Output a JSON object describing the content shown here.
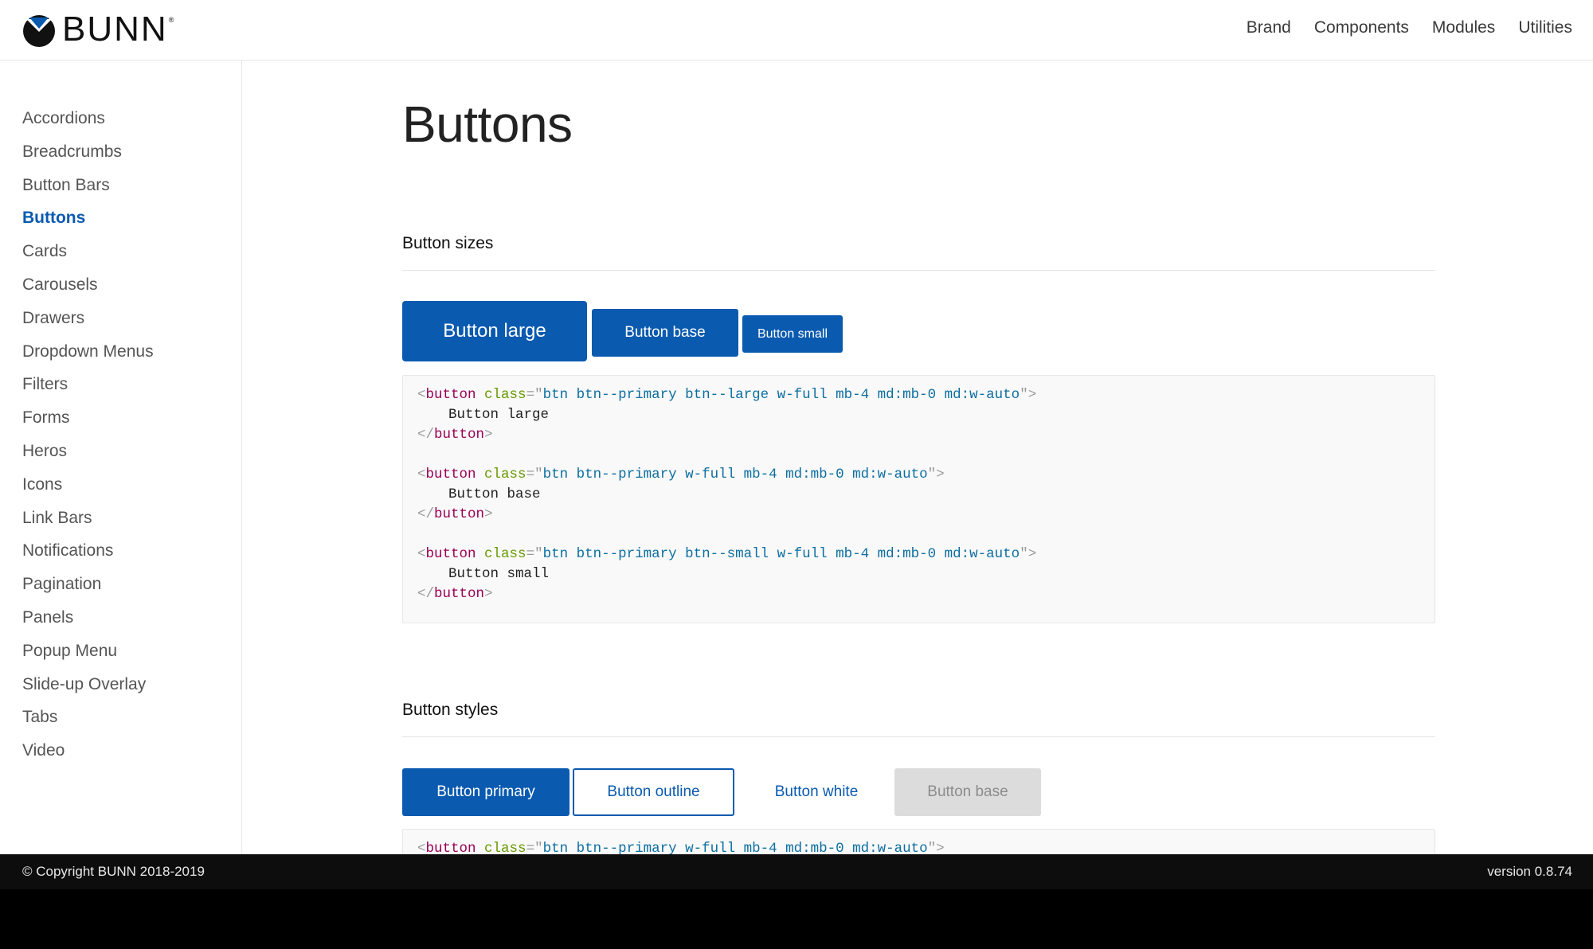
{
  "brand": {
    "name": "BUNN",
    "registered_mark": "®",
    "accent_color": "#0a5ab0"
  },
  "topnav": [
    "Brand",
    "Components",
    "Modules",
    "Utilities"
  ],
  "sidebar": {
    "items": [
      "Accordions",
      "Breadcrumbs",
      "Button Bars",
      "Buttons",
      "Cards",
      "Carousels",
      "Drawers",
      "Dropdown Menus",
      "Filters",
      "Forms",
      "Heros",
      "Icons",
      "Link Bars",
      "Notifications",
      "Pagination",
      "Panels",
      "Popup Menu",
      "Slide-up Overlay",
      "Tabs",
      "Video"
    ],
    "active": "Buttons"
  },
  "main": {
    "title": "Buttons",
    "sizes": {
      "heading": "Button sizes",
      "buttons": {
        "large": "Button large",
        "base": "Button base",
        "small": "Button small"
      },
      "code": [
        {
          "tag": "button",
          "attr": "class",
          "value": "btn btn--primary btn--large w-full mb-4 md:mb-0 md:w-auto",
          "text": "Button large"
        },
        {
          "tag": "button",
          "attr": "class",
          "value": "btn btn--primary w-full mb-4 md:mb-0 md:w-auto",
          "text": "Button base"
        },
        {
          "tag": "button",
          "attr": "class",
          "value": "btn btn--primary btn--small w-full mb-4 md:mb-0 md:w-auto",
          "text": "Button small"
        }
      ]
    },
    "styles": {
      "heading": "Button styles",
      "buttons": {
        "primary": "Button primary",
        "outline": "Button outline",
        "white": "Button white",
        "base": "Button base"
      },
      "code_first": {
        "tag": "button",
        "attr": "class",
        "value": "btn btn--primary w-full mb-4 md:mb-0 md:w-auto"
      }
    }
  },
  "footer": {
    "copyright": "© Copyright BUNN 2018-2019",
    "version": "version 0.8.74"
  }
}
